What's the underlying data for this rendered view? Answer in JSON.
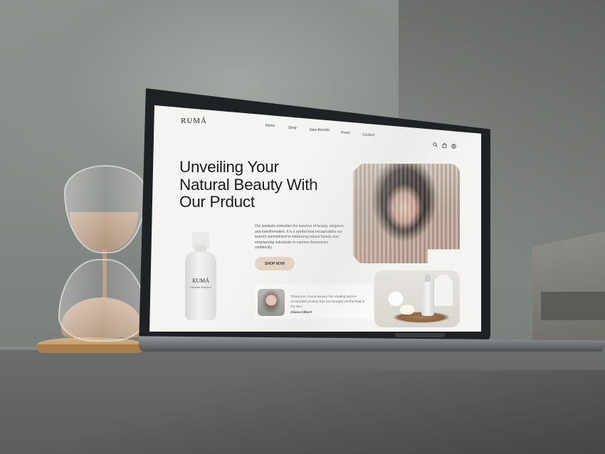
{
  "brand": {
    "logo": "RUMÁ"
  },
  "nav": {
    "items": [
      {
        "label": "Home"
      },
      {
        "label": "Shop"
      },
      {
        "label": "New Arrivals"
      },
      {
        "label": "Press"
      },
      {
        "label": "Contact"
      }
    ],
    "icons": [
      "search-icon",
      "bag-icon",
      "user-icon"
    ]
  },
  "hero": {
    "title": "Unveiling Your\nNatural Beauty With\nOur Prduct",
    "description": "Our products embodies the essence of beauty, elegance, and transformation. It is a symbol that encapsulates our brand's commitment to enhancing natural beauty and empowering individuals to express themselves confidently.",
    "cta_label": "SHOP NOW"
  },
  "product_bottle": {
    "brand": "RUMÁ",
    "label": "Essential Shampoo"
  },
  "testimonial": {
    "quote": "Thank you, Ruma Beauty, for creating such a remarkable product that has brought out the best in my skin!",
    "author": "Aliana Gilbert"
  },
  "colors": {
    "cta_background": "#e6d2c2",
    "screen_background": "#f4f4f2",
    "text_dark": "#1d1d1d"
  }
}
